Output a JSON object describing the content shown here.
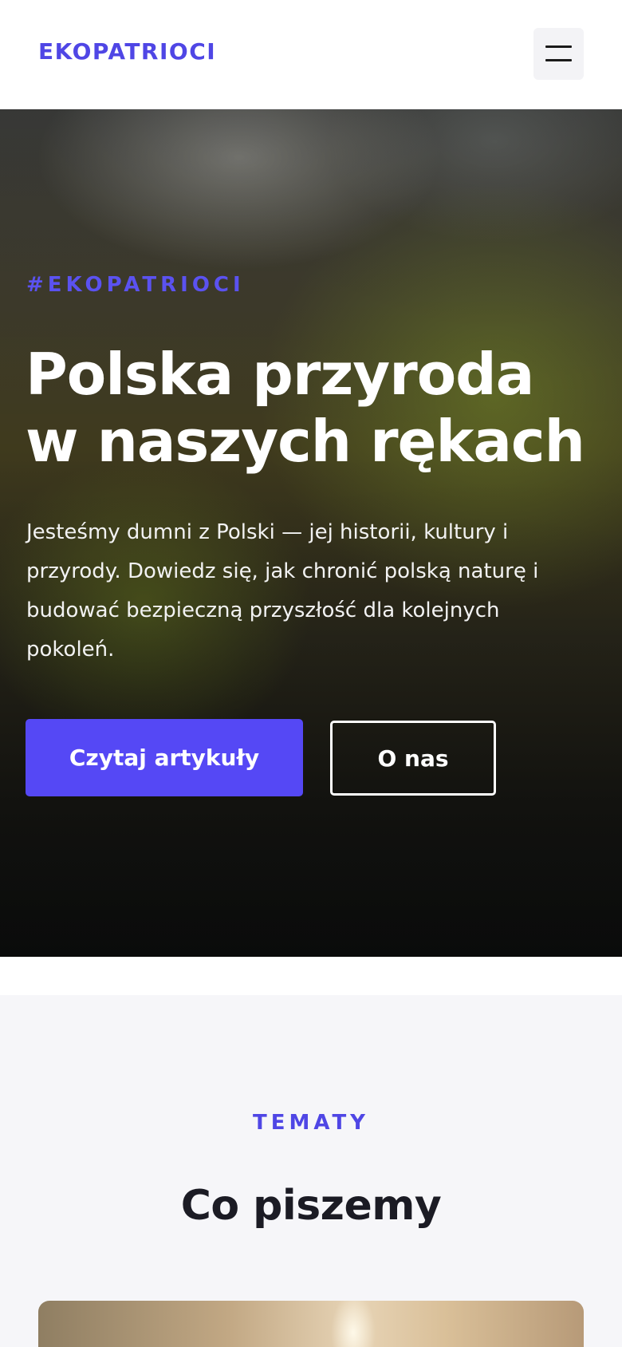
{
  "header": {
    "logo": "EKOPATRIOCI",
    "menu_icon": "hamburger-menu-icon"
  },
  "hero": {
    "tag": "#EKOPATRIOCI",
    "title_line1": "Polska przyroda",
    "title_line2": "w naszych rękach",
    "description": "Jesteśmy dumni z Polski — jej historii, kultury i przyrody. Dowiedz się, jak chronić polską naturę i budować bezpieczną przyszłość dla kolejnych pokoleń.",
    "primary_button": "Czytaj artykuły",
    "secondary_button": "O nas"
  },
  "topics": {
    "eyebrow": "TEMATY",
    "title": "Co piszemy"
  },
  "colors": {
    "accent": "#4f46e5",
    "button_primary": "#5548f5",
    "section_bg": "#f6f6f9",
    "heading_dark": "#1b1b24"
  }
}
